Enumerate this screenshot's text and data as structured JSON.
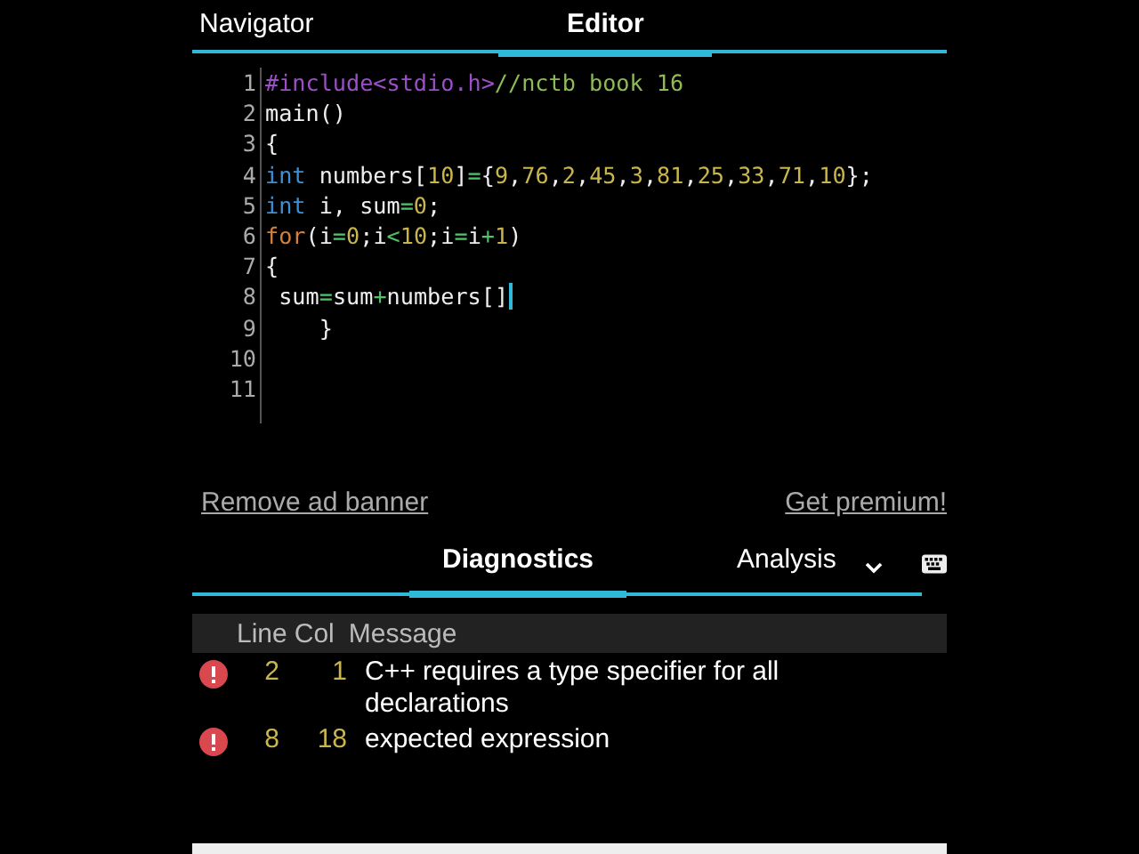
{
  "top_tabs": [
    {
      "label": "Navigator",
      "selected": false
    },
    {
      "label": "Editor",
      "selected": true
    }
  ],
  "editor": {
    "lines": [
      {
        "number": "1",
        "tokens": [
          {
            "kind": "preproc",
            "text": "#include<stdio.h>"
          },
          {
            "kind": "comment",
            "text": "//nctb book 16"
          }
        ]
      },
      {
        "number": "2",
        "tokens": [
          {
            "kind": "plain",
            "text": "main()"
          }
        ]
      },
      {
        "number": "3",
        "tokens": [
          {
            "kind": "plain",
            "text": "{"
          }
        ]
      },
      {
        "number": "4",
        "tokens": [
          {
            "kind": "type",
            "text": "int"
          },
          {
            "kind": "plain",
            "text": " numbers["
          },
          {
            "kind": "number",
            "text": "10"
          },
          {
            "kind": "plain",
            "text": "]"
          },
          {
            "kind": "operator",
            "text": "="
          },
          {
            "kind": "plain",
            "text": "{"
          },
          {
            "kind": "number",
            "text": "9"
          },
          {
            "kind": "plain",
            "text": ","
          },
          {
            "kind": "number",
            "text": "76"
          },
          {
            "kind": "plain",
            "text": ","
          },
          {
            "kind": "number",
            "text": "2"
          },
          {
            "kind": "plain",
            "text": ","
          },
          {
            "kind": "number",
            "text": "45"
          },
          {
            "kind": "plain",
            "text": ","
          },
          {
            "kind": "number",
            "text": "3"
          },
          {
            "kind": "plain",
            "text": ","
          },
          {
            "kind": "number",
            "text": "81"
          },
          {
            "kind": "plain",
            "text": ","
          },
          {
            "kind": "number",
            "text": "25"
          },
          {
            "kind": "plain",
            "text": ","
          },
          {
            "kind": "number",
            "text": "33"
          },
          {
            "kind": "plain",
            "text": ","
          },
          {
            "kind": "number",
            "text": "71"
          },
          {
            "kind": "plain",
            "text": ","
          },
          {
            "kind": "number",
            "text": "10"
          },
          {
            "kind": "plain",
            "text": "};"
          }
        ]
      },
      {
        "number": "5",
        "tokens": [
          {
            "kind": "type",
            "text": "int"
          },
          {
            "kind": "plain",
            "text": " i, sum"
          },
          {
            "kind": "operator",
            "text": "="
          },
          {
            "kind": "number",
            "text": "0"
          },
          {
            "kind": "plain",
            "text": ";"
          }
        ]
      },
      {
        "number": "6",
        "tokens": [
          {
            "kind": "keyword",
            "text": "for"
          },
          {
            "kind": "plain",
            "text": "(i"
          },
          {
            "kind": "operator",
            "text": "="
          },
          {
            "kind": "number",
            "text": "0"
          },
          {
            "kind": "plain",
            "text": ";i"
          },
          {
            "kind": "operator",
            "text": "<"
          },
          {
            "kind": "number",
            "text": "10"
          },
          {
            "kind": "plain",
            "text": ";i"
          },
          {
            "kind": "operator",
            "text": "="
          },
          {
            "kind": "plain",
            "text": "i"
          },
          {
            "kind": "operator",
            "text": "+"
          },
          {
            "kind": "number",
            "text": "1"
          },
          {
            "kind": "plain",
            "text": ")"
          }
        ]
      },
      {
        "number": "7",
        "tokens": [
          {
            "kind": "plain",
            "text": "{"
          }
        ]
      },
      {
        "number": "8",
        "cursor": true,
        "tokens": [
          {
            "kind": "plain",
            "text": " sum"
          },
          {
            "kind": "operator",
            "text": "="
          },
          {
            "kind": "plain",
            "text": "sum"
          },
          {
            "kind": "operator",
            "text": "+"
          },
          {
            "kind": "plain",
            "text": "numbers[]"
          }
        ]
      },
      {
        "number": "9",
        "tokens": [
          {
            "kind": "plain",
            "text": "    }"
          }
        ]
      },
      {
        "number": "10"
      },
      {
        "number": "11"
      }
    ]
  },
  "links": [
    "Remove ad banner",
    "Get premium!"
  ],
  "bottom_tabs": [
    {
      "label": "Diagnostics",
      "selected": true
    },
    {
      "label": "Analysis",
      "selected": false
    }
  ],
  "diagnostics": {
    "columns": [
      "Line",
      "Col",
      "Message"
    ],
    "rows": [
      {
        "kind": "error",
        "line": "2",
        "col": "1",
        "message": "C++ requires a type specifier for all declarations"
      },
      {
        "kind": "error",
        "line": "8",
        "col": "18",
        "message": "expected expression"
      }
    ]
  }
}
